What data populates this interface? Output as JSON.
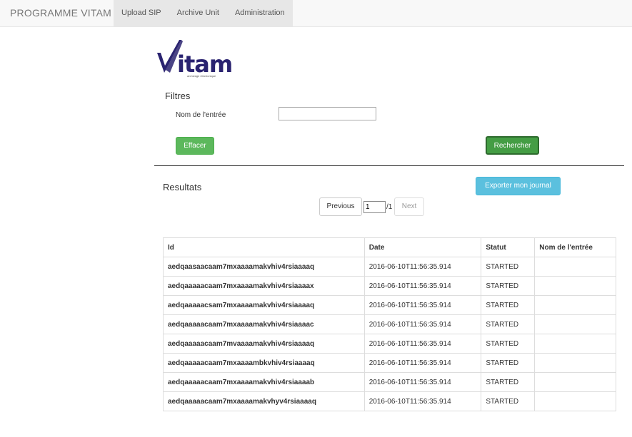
{
  "navbar": {
    "brand": "PROGRAMME VITAM",
    "items": [
      {
        "label": "Upload SIP"
      },
      {
        "label": "Archive Unit"
      },
      {
        "label": "Administration"
      }
    ]
  },
  "logo": {
    "wordmark": "itam",
    "tagline": "archivage électronique",
    "brand_color": "#2a2370"
  },
  "filters": {
    "title": "Filtres",
    "name_label": "Nom de l'entrée",
    "name_value": "",
    "clear_label": "Effacer",
    "search_label": "Rechercher"
  },
  "results": {
    "title": "Resultats",
    "export_label": "Exporter mon journal",
    "pagination": {
      "previous_label": "Previous",
      "page": "1",
      "total": "/1",
      "next_label": "Next"
    },
    "columns": [
      "Id",
      "Date",
      "Statut",
      "Nom de l'entrée"
    ],
    "rows": [
      {
        "id": "aedqaasaacaam7mxaaaamakvhiv4rsiaaaaq",
        "date": "2016-06-10T11:56:35.914",
        "status": "STARTED",
        "name": ""
      },
      {
        "id": "aedqaaaaacaam7mxaaaamakvhiv4rsiaaaax",
        "date": "2016-06-10T11:56:35.914",
        "status": "STARTED",
        "name": ""
      },
      {
        "id": "aedqaaaaacsam7mxaaaamakvhiv4rsiaaaaq",
        "date": "2016-06-10T11:56:35.914",
        "status": "STARTED",
        "name": ""
      },
      {
        "id": "aedqaaaaacaam7mxaaaamakvhiv4rsiaaaac",
        "date": "2016-06-10T11:56:35.914",
        "status": "STARTED",
        "name": ""
      },
      {
        "id": "aedqaaaaacaam7mvaaaamakvhiv4rsiaaaaq",
        "date": "2016-06-10T11:56:35.914",
        "status": "STARTED",
        "name": ""
      },
      {
        "id": "aedqaaaaacaam7mxaaaambkvhiv4rsiaaaaq",
        "date": "2016-06-10T11:56:35.914",
        "status": "STARTED",
        "name": ""
      },
      {
        "id": "aedqaaaaacaam7mxaaaamakvhiv4rsiaaaab",
        "date": "2016-06-10T11:56:35.914",
        "status": "STARTED",
        "name": ""
      },
      {
        "id": "aedqaaaaacaam7mxaaaamakvhyv4rsiaaaaq",
        "date": "2016-06-10T11:56:35.914",
        "status": "STARTED",
        "name": ""
      }
    ]
  }
}
